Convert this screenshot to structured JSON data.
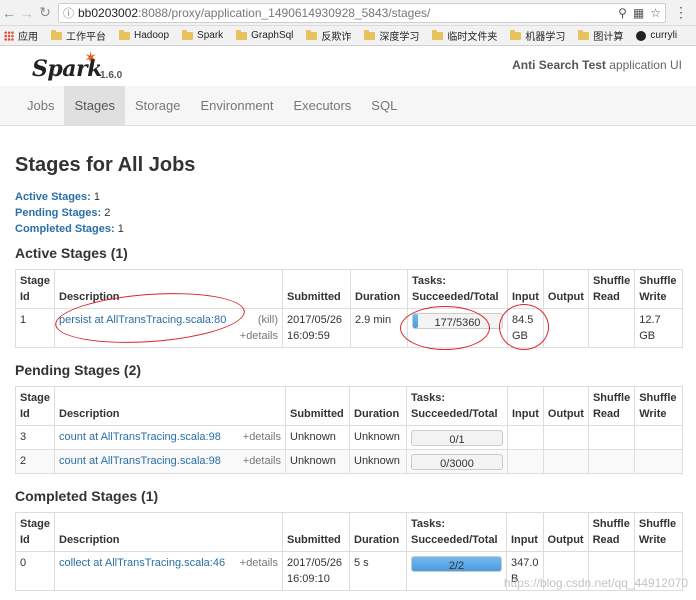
{
  "browser": {
    "url_host": "bb0203002",
    "url_path": ":8088/proxy/application_1490614930928_5843/stages/",
    "bookmarks": [
      "应用",
      "工作平台",
      "Hadoop",
      "Spark",
      "GraphSql",
      "反欺诈",
      "深度学习",
      "临时文件夹",
      "机器学习",
      "图计算",
      "curryli"
    ]
  },
  "header": {
    "logo_text": "Spark",
    "version": "1.6.0",
    "app_name_bold": "Anti Search Test",
    "app_name_suffix": "application UI"
  },
  "tabs": [
    "Jobs",
    "Stages",
    "Storage",
    "Environment",
    "Executors",
    "SQL"
  ],
  "page_title": "Stages for All Jobs",
  "summary": {
    "active_label": "Active Stages:",
    "active_count": "1",
    "pending_label": "Pending Stages:",
    "pending_count": "2",
    "completed_label": "Completed Stages:",
    "completed_count": "1"
  },
  "active": {
    "heading": "Active Stages (1)",
    "rows": [
      {
        "id": "1",
        "desc": "persist at AllTransTracing.scala:80",
        "kill": "(kill)",
        "details": "+details",
        "submitted": "2017/05/26 16:09:59",
        "duration": "2.9 min",
        "tasks": "177/5360",
        "progress": 0.033,
        "input": "84.5 GB",
        "output": "",
        "shuffle_read": "",
        "shuffle_write": "12.7 GB"
      }
    ]
  },
  "pending": {
    "heading": "Pending Stages (2)",
    "rows": [
      {
        "id": "3",
        "desc": "count at AllTransTracing.scala:98",
        "details": "+details",
        "submitted": "Unknown",
        "duration": "Unknown",
        "tasks": "0/1",
        "progress": 0,
        "input": "",
        "output": "",
        "shuffle_read": "",
        "shuffle_write": ""
      },
      {
        "id": "2",
        "desc": "count at AllTransTracing.scala:98",
        "details": "+details",
        "submitted": "Unknown",
        "duration": "Unknown",
        "tasks": "0/3000",
        "progress": 0,
        "input": "",
        "output": "",
        "shuffle_read": "",
        "shuffle_write": ""
      }
    ]
  },
  "completed": {
    "heading": "Completed Stages (1)",
    "rows": [
      {
        "id": "0",
        "desc": "collect at AllTransTracing.scala:46",
        "details": "+details",
        "submitted": "2017/05/26 16:09:10",
        "duration": "5 s",
        "tasks": "2/2",
        "progress": 1,
        "input": "347.0 B",
        "output": "",
        "shuffle_read": "",
        "shuffle_write": ""
      }
    ]
  },
  "columns": {
    "stage_id": "Stage Id",
    "description": "Description",
    "submitted": "Submitted",
    "duration": "Duration",
    "tasks": "Tasks: Succeeded/Total",
    "input": "Input",
    "output": "Output",
    "shuffle_read": "Shuffle Read",
    "shuffle_write": "Shuffle Write"
  },
  "watermark": "https://blog.csdn.net/qq_44912070",
  "colors": {
    "link": "#2a6fa8",
    "progress": "#4a9be0",
    "annotation": "#d8262b",
    "spark_orange": "#e25a1c"
  }
}
